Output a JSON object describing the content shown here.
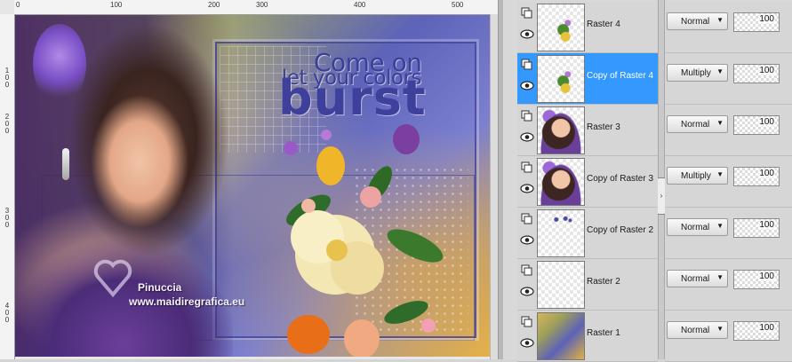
{
  "canvas": {
    "ruler_top_labels": [
      "0",
      "100",
      "200",
      "300",
      "400",
      "500"
    ],
    "ruler_left_labels": [
      "100",
      "200",
      "300",
      "400"
    ],
    "artwork": {
      "title_line1": "Come on",
      "title_line2": "let your colors",
      "title_line3": "burst",
      "watermark_name": "Pinuccia",
      "watermark_url": "www.maidiregrafica.eu"
    }
  },
  "layers": [
    {
      "name": "Raster 4",
      "blend_mode": "Normal",
      "opacity": "100",
      "selected": false,
      "thumb": "flowers"
    },
    {
      "name": "Copy of Raster 4",
      "blend_mode": "Multiply",
      "opacity": "100",
      "selected": true,
      "thumb": "flowers"
    },
    {
      "name": "Raster 3",
      "blend_mode": "Normal",
      "opacity": "100",
      "selected": false,
      "thumb": "woman"
    },
    {
      "name": "Copy of Raster 3",
      "blend_mode": "Multiply",
      "opacity": "100",
      "selected": false,
      "thumb": "woman"
    },
    {
      "name": "Copy of Raster 2",
      "blend_mode": "Normal",
      "opacity": "100",
      "selected": false,
      "thumb": "text"
    },
    {
      "name": "Raster 2",
      "blend_mode": "Normal",
      "opacity": "100",
      "selected": false,
      "thumb": "empty"
    },
    {
      "name": "Raster 1",
      "blend_mode": "Normal",
      "opacity": "100",
      "selected": false,
      "thumb": "background"
    }
  ],
  "colors": {
    "selected_row": "#3399ff",
    "title_text": "#3b3f97"
  }
}
